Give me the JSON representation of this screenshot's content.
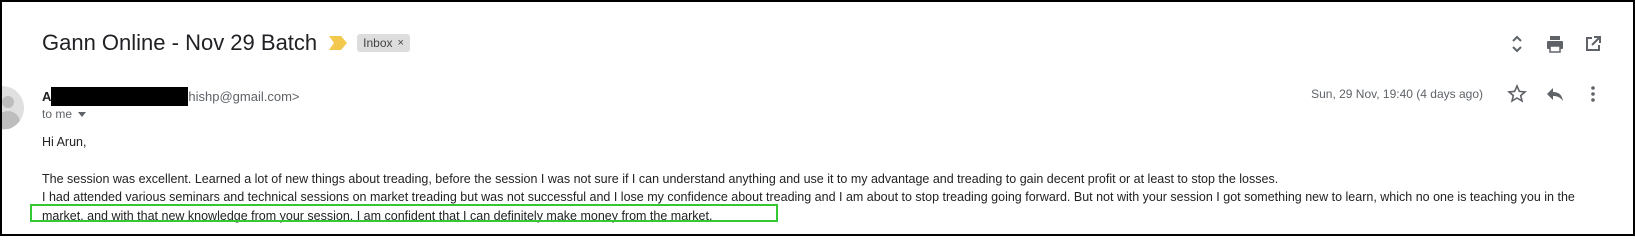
{
  "email": {
    "subject": "Gann Online - Nov 29 Batch",
    "label": "Inbox",
    "label_close": "×",
    "sender_initial": "A",
    "sender_email_fragment": "hishp@gmail.com>",
    "to": "to me",
    "date": "Sun, 29 Nov, 19:40 (4 days ago)",
    "greeting": "Hi Arun,",
    "paragraph1": "The session was excellent. Learned a lot of new things about treading, before the session I was not sure if I can understand anything and use it to my advantage and treading to gain decent profit or at least to stop the losses.",
    "paragraph2": "I had attended various seminars and technical sessions on market treading but was not successful and I lose my confidence about treading and I am about to stop treading going forward. But not with your session I got something new to learn, which no one is  teaching you in the market. and with that new knowledge from your session, I am confident that I can definitely make money from the market."
  },
  "icons": {
    "important": "important-marker-icon",
    "expand": "expand-collapse-icon",
    "print": "print-icon",
    "popout": "open-in-new-window-icon",
    "star": "star-icon",
    "reply": "reply-icon",
    "more": "more-vertical-icon",
    "avatar": "avatar-icon"
  },
  "colors": {
    "important_marker": "#f2c94c",
    "label_chip_bg": "#dddddd",
    "highlight_border": "#34c934",
    "redaction": "#000000"
  }
}
